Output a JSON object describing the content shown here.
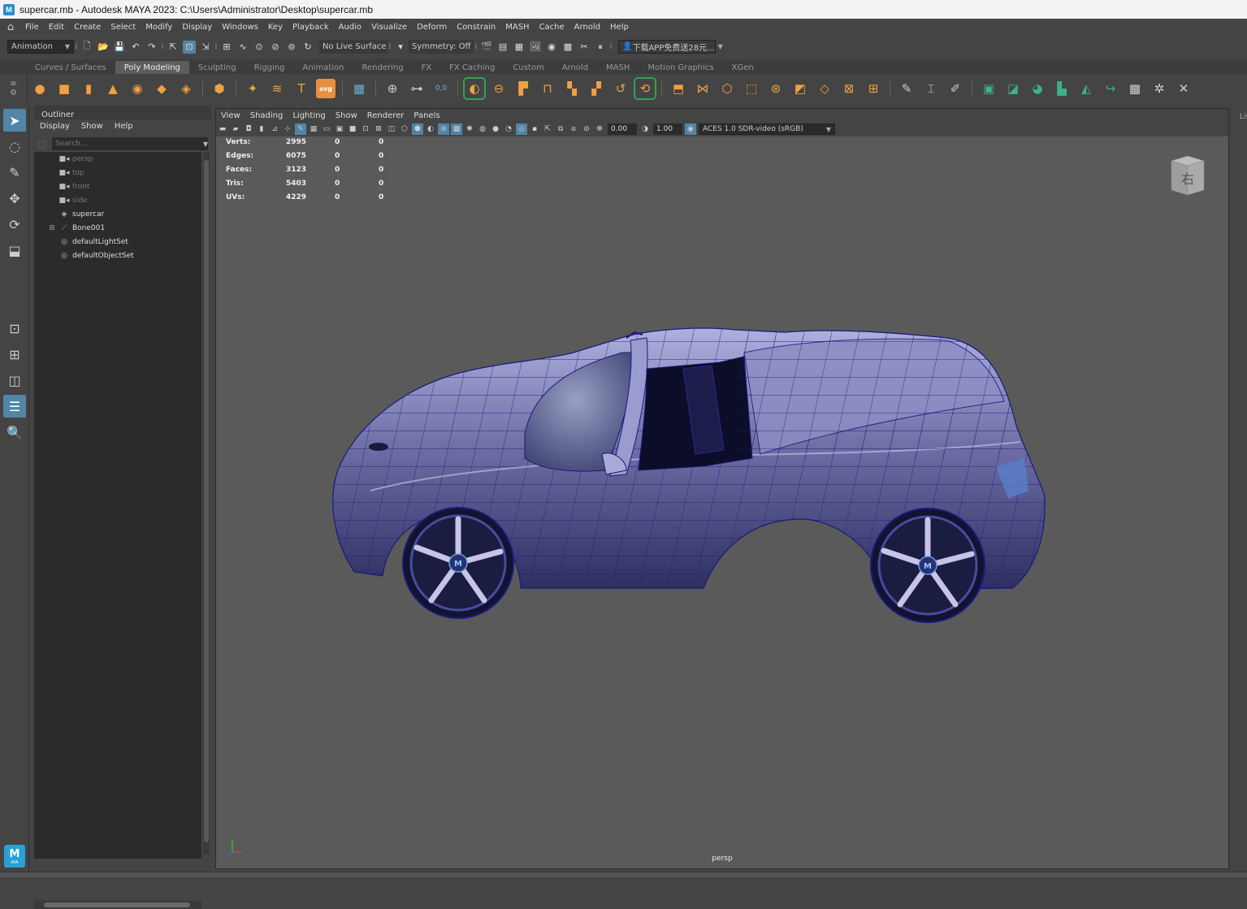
{
  "window": {
    "title": "supercar.mb - Autodesk MAYA 2023: C:\\Users\\Administrator\\Desktop\\supercar.mb"
  },
  "menubar": [
    "File",
    "Edit",
    "Create",
    "Select",
    "Modify",
    "Display",
    "Windows",
    "Key",
    "Playback",
    "Audio",
    "Visualize",
    "Deform",
    "Constrain",
    "MASH",
    "Cache",
    "Arnold",
    "Help"
  ],
  "statusline": {
    "menuset": "Animation",
    "live_surface": "No Live Surface",
    "symmetry": "Symmetry: Off",
    "account": "下载APP免费送28元..."
  },
  "shelf": {
    "tabs": [
      "Curves / Surfaces",
      "Poly Modeling",
      "Sculpting",
      "Rigging",
      "Animation",
      "Rendering",
      "FX",
      "FX Caching",
      "Custom",
      "Arnold",
      "MASH",
      "Motion Graphics",
      "XGen"
    ],
    "active_tab": "Poly Modeling"
  },
  "outliner": {
    "title": "Outliner",
    "menu": [
      "Display",
      "Show",
      "Help"
    ],
    "search_placeholder": "Search...",
    "items": [
      {
        "label": "persp",
        "icon": "camera-icon",
        "dim": true,
        "expandable": false
      },
      {
        "label": "top",
        "icon": "camera-icon",
        "dim": true,
        "expandable": false
      },
      {
        "label": "front",
        "icon": "camera-icon",
        "dim": true,
        "expandable": false
      },
      {
        "label": "side",
        "icon": "camera-icon",
        "dim": true,
        "expandable": false
      },
      {
        "label": "supercar",
        "icon": "mesh-icon",
        "dim": false,
        "expandable": false
      },
      {
        "label": "Bone001",
        "icon": "joint-icon",
        "dim": false,
        "expandable": true
      },
      {
        "label": "defaultLightSet",
        "icon": "set-icon",
        "dim": false,
        "expandable": false
      },
      {
        "label": "defaultObjectSet",
        "icon": "set-icon",
        "dim": false,
        "expandable": false
      }
    ]
  },
  "viewport": {
    "menu": [
      "View",
      "Shading",
      "Lighting",
      "Show",
      "Renderer",
      "Panels"
    ],
    "exposure": "0.00",
    "gamma": "1.00",
    "color_transform": "ACES 1.0 SDR-video (sRGB)",
    "camera": "persp",
    "viewcube_label": "右",
    "hud": [
      {
        "label": "Verts:",
        "value": "2995",
        "a": "0",
        "b": "0"
      },
      {
        "label": "Edges:",
        "value": "6075",
        "a": "0",
        "b": "0"
      },
      {
        "label": "Faces:",
        "value": "3123",
        "a": "0",
        "b": "0"
      },
      {
        "label": "Tris:",
        "value": "5403",
        "a": "0",
        "b": "0"
      },
      {
        "label": "UVs:",
        "value": "4229",
        "a": "0",
        "b": "0"
      }
    ]
  },
  "right_panel": {
    "label": "Lis"
  },
  "logo": {
    "text": "M",
    "sub": "AYA"
  }
}
